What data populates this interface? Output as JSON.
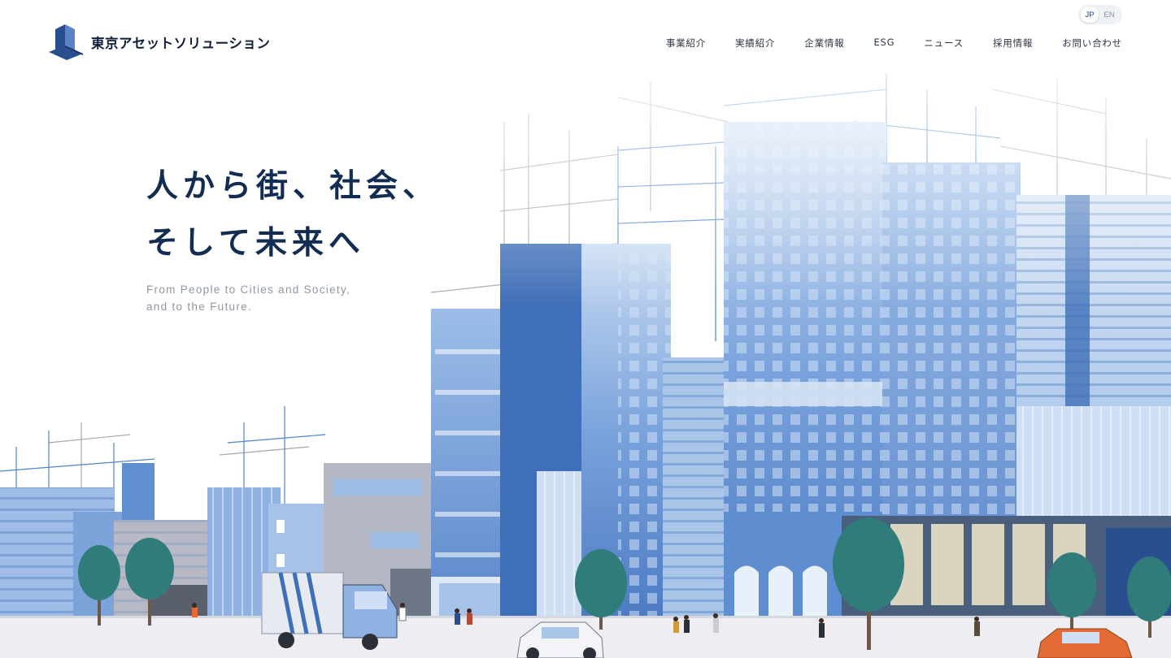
{
  "header": {
    "logo_text": "東京アセットソリューション",
    "lang": {
      "jp": "JP",
      "en": "EN",
      "active": "JP"
    },
    "nav": [
      {
        "label": "事業紹介"
      },
      {
        "label": "実績紹介"
      },
      {
        "label": "企業情報"
      },
      {
        "label": "ESG"
      },
      {
        "label": "ニュース"
      },
      {
        "label": "採用情報"
      },
      {
        "label": "お問い合わせ"
      }
    ]
  },
  "hero": {
    "headline_line1": "人から街、社会、",
    "headline_line2": "そして未来へ",
    "subcopy_line1": "From People to Cities and Society,",
    "subcopy_line2": "and to the Future."
  },
  "illustration": {
    "icon": "city-street-illustration",
    "colors": {
      "sky_fade": "#ffffff",
      "glass_light": "#a9c6e8",
      "glass_mid": "#6f9ad6",
      "glass_dark": "#3f6fb8",
      "navy": "#2a4f8f",
      "tree": "#2f7c7a",
      "road": "#eeeef2",
      "car_orange": "#e46b34"
    }
  }
}
